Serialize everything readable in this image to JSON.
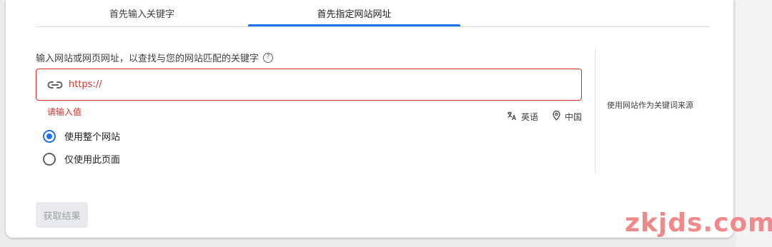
{
  "tabs": [
    {
      "label": "首先输入关键字",
      "active": false
    },
    {
      "label": "首先指定网站网址",
      "active": true
    }
  ],
  "prompt": {
    "text": "输入网站或网页网址，以查找与您的网站匹配的关键字",
    "help_icon": "help-circle-icon"
  },
  "url_input": {
    "placeholder": "https://",
    "value": "",
    "icon": "link-icon"
  },
  "error_text": "请输入值",
  "meta": {
    "language": "英语",
    "location": "中国",
    "language_icon": "translate-icon",
    "location_icon": "location-pin-icon"
  },
  "scope_options": [
    {
      "label": "使用整个网站",
      "checked": true
    },
    {
      "label": "仅使用此页面",
      "checked": false
    }
  ],
  "side_note": "使用网站作为关键词来源",
  "submit_label": "获取结果",
  "watermark": "zkjds.com",
  "colors": {
    "accent": "#1a73e8",
    "error": "#d93025",
    "watermark": "#f08a8a"
  }
}
